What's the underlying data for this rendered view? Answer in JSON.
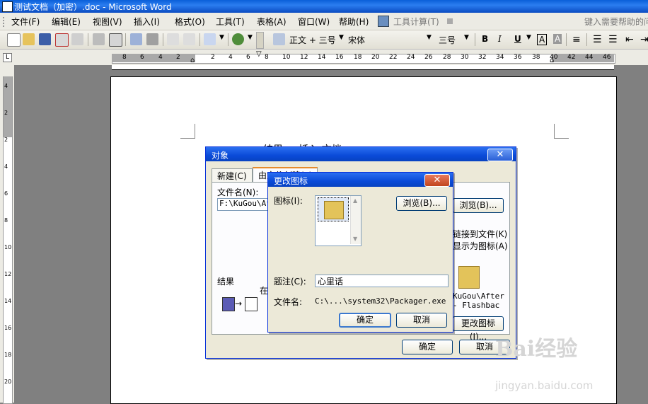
{
  "window": {
    "title": "测试文档（加密）.doc - Microsoft Word"
  },
  "menu": {
    "items": [
      "文件(F)",
      "编辑(E)",
      "视图(V)",
      "插入(I)",
      "格式(O)",
      "工具(T)",
      "表格(A)",
      "窗口(W)",
      "帮助(H)",
      "工具计算(T)"
    ],
    "help_placeholder": "键入需要帮助的问"
  },
  "toolbar": {
    "style": "正文 + 三号",
    "font": "宋体",
    "size": "三号",
    "bold": "B",
    "italic": "I",
    "underline": "U",
    "font_color": "A",
    "highlight": "A"
  },
  "ruler": {
    "horizontal": [
      "8",
      "6",
      "4",
      "2",
      "2",
      "4",
      "6",
      "8",
      "10",
      "12",
      "14",
      "16",
      "18",
      "20",
      "22",
      "24",
      "26",
      "28",
      "30",
      "32",
      "34",
      "36",
      "38",
      "40",
      "42",
      "44",
      "46"
    ],
    "vertical": [
      "4",
      "2",
      "2",
      "4",
      "6",
      "8",
      "10",
      "12",
      "14",
      "16",
      "18",
      "20"
    ]
  },
  "document": {
    "partial_text": "结果   ...  插入  文档"
  },
  "object_dialog": {
    "title": "对象",
    "tabs": [
      "新建(C)",
      "由文件创建(F)"
    ],
    "filename_label": "文件名(N):",
    "filename_value": "F:\\KuGou\\After",
    "browse_button": "浏览(B)...",
    "link_option": "链接到文件(K)",
    "icon_option": "显示为图标(A)",
    "icon_caption_line1": "KuGou\\After",
    "icon_caption_line2": "- Flashbac",
    "change_icon_button": "更改图标(I)...",
    "result_label": "结果",
    "result_text": "在",
    "ok": "确定",
    "cancel": "取消"
  },
  "change_icon_dialog": {
    "title": "更改图标",
    "icon_label": "图标(I):",
    "browse_button": "浏览(B)...",
    "caption_label": "题注(C):",
    "caption_value": "心里话",
    "filename_label": "文件名:",
    "filename_value": "C:\\...\\system32\\Packager.exe",
    "ok": "确定",
    "cancel": "取消"
  },
  "watermark": {
    "brand": "Bai经验",
    "url": "jingyan.baidu.com"
  },
  "colors": {
    "titlebar": "#0a5fd8",
    "dialog_bg": "#ece9d8",
    "close_red": "#c1441d",
    "workspace": "#808080"
  }
}
